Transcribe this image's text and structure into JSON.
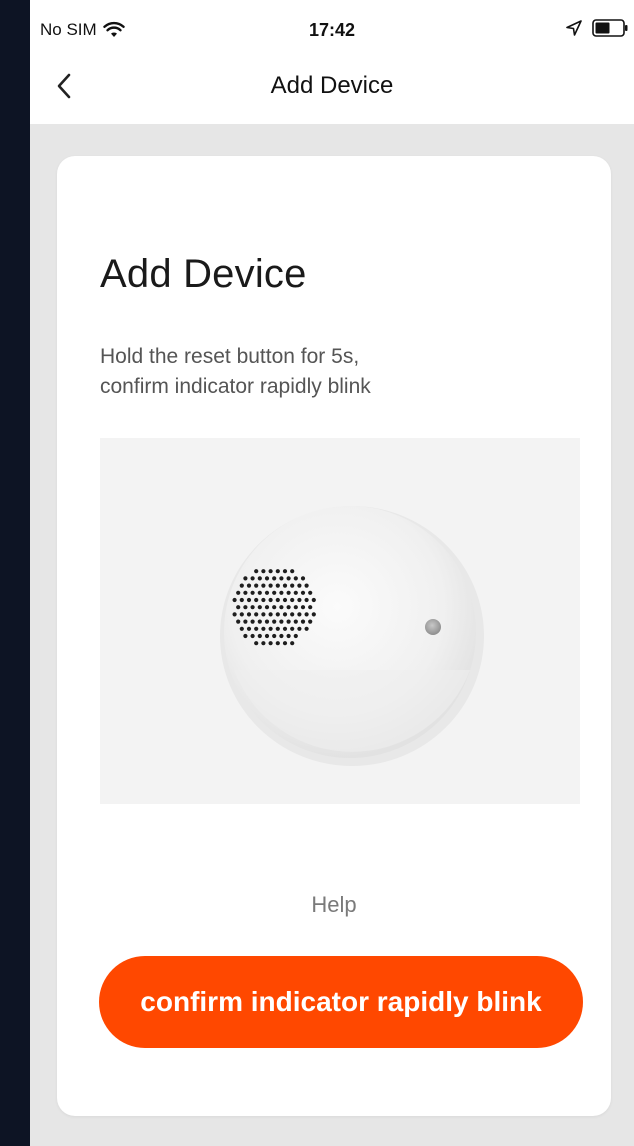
{
  "status_bar": {
    "carrier": "No SIM",
    "time": "17:42",
    "wifi_icon": "wifi-icon",
    "location_icon": "location-arrow-icon",
    "battery_icon": "battery-icon"
  },
  "nav": {
    "back_icon": "chevron-left-icon",
    "title": "Add Device"
  },
  "card": {
    "title": "Add Device",
    "description_line1": "Hold the reset button for 5s,",
    "description_line2": "confirm indicator rapidly blink",
    "image": "smoke-detector-device-image",
    "help_label": "Help",
    "confirm_label": "confirm indicator rapidly blink"
  },
  "colors": {
    "accent": "#ff4800",
    "page_background": "#e6e6e6",
    "card_background": "#ffffff",
    "frame_background": "#0d1424"
  }
}
